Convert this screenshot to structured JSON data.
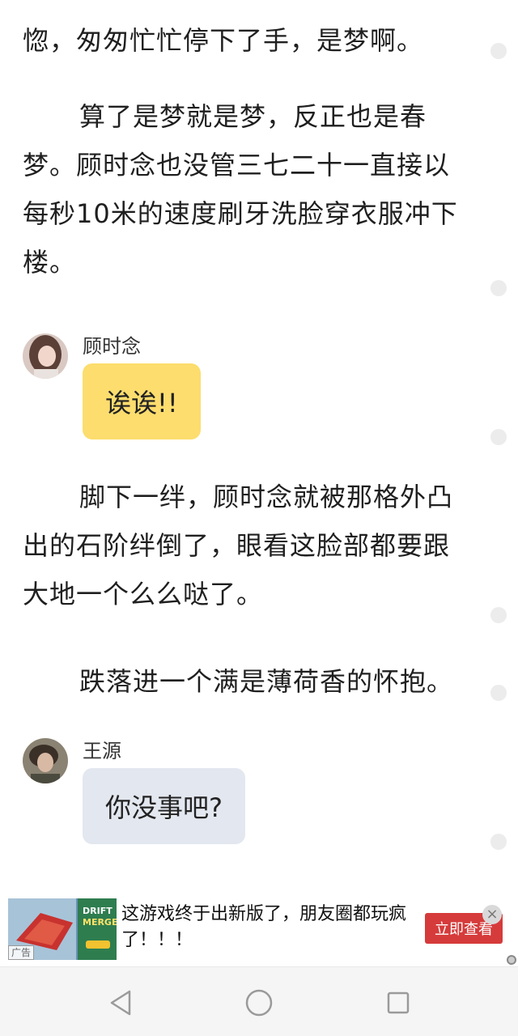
{
  "story": {
    "paragraph_1": "惚，匆匆忙忙停下了手，是梦啊。",
    "paragraph_2": "算了是梦就是梦，反正也是春梦。顾时念也没管三七二十一直接以每秒10米的速度刷牙洗脸穿衣服冲下楼。",
    "paragraph_3": "脚下一绊，顾时念就被那格外凸出的石阶绊倒了，眼看这脸部都要跟大地一个么么哒了。",
    "paragraph_4": "跌落进一个满是薄荷香的怀抱。"
  },
  "chat": [
    {
      "speaker": "顾时念",
      "message": "诶诶!!",
      "bubble_color": "#fcdd6e"
    },
    {
      "speaker": "王源",
      "message": "你没事吧?",
      "bubble_color": "#e3e7ef"
    }
  ],
  "ad": {
    "text": "这游戏终于出新版了，朋友圈都玩疯了！！！",
    "cta_label": "立即查看",
    "tag": "广告",
    "thumb_label_1": "DRIFT",
    "thumb_label_2": "MERGE",
    "close_symbol": "×",
    "cta_color": "#d63b3b"
  },
  "nav": {
    "back_icon": "triangle-back-icon",
    "home_icon": "circle-home-icon",
    "recents_icon": "square-recents-icon"
  }
}
